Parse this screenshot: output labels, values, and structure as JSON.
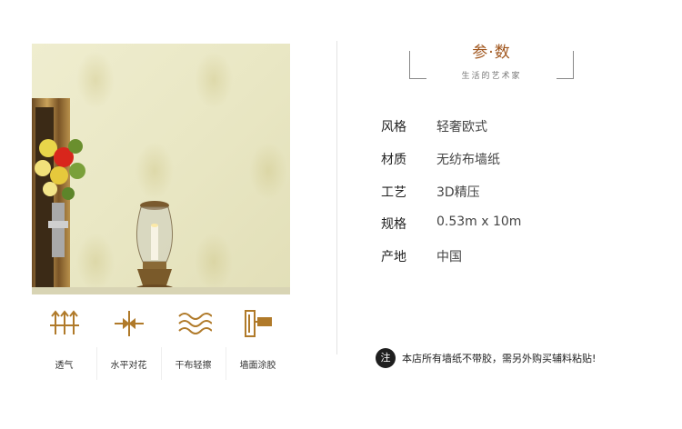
{
  "heading": {
    "title": "参·数",
    "subtitle": "生活的艺术家"
  },
  "specs": [
    {
      "key": "风格",
      "value": "轻奢欧式"
    },
    {
      "key": "材质",
      "value": "无纺布墙纸"
    },
    {
      "key": "工艺",
      "value": "3D精压"
    },
    {
      "key": "规格",
      "value": "0.53m x 10m"
    },
    {
      "key": "产地",
      "value": "中国"
    }
  ],
  "features": [
    {
      "label": "透气",
      "icon": "breathable-arrows-icon"
    },
    {
      "label": "水平对花",
      "icon": "pattern-align-icon"
    },
    {
      "label": "干布轻擦",
      "icon": "wave-wipe-icon"
    },
    {
      "label": "墙面涂胶",
      "icon": "glue-roller-icon"
    }
  ],
  "note": {
    "icon_text": "注",
    "text": "本店所有墙纸不带胶，需另外购买辅料粘贴!"
  },
  "colors": {
    "accent": "#a0561d",
    "icon": "#b07a2a",
    "wallpaper": "#ebe8c8"
  }
}
